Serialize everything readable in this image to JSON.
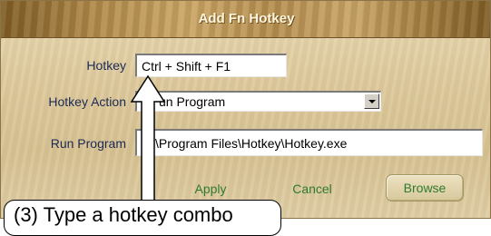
{
  "dialog": {
    "title": "Add Fn Hotkey"
  },
  "form": {
    "hotkey_label": "Hotkey",
    "hotkey_value": "Ctrl + Shift + F1",
    "action_label": "Hotkey Action",
    "action_value": "Run Program",
    "action_visible": "un Program",
    "program_label": "Run Program",
    "program_value": "C:\\Program Files\\Hotkey\\Hotkey.exe",
    "program_visible": "\\Program Files\\Hotkey\\Hotkey.exe"
  },
  "buttons": {
    "apply": "Apply",
    "cancel": "Cancel",
    "browse": "Browse"
  },
  "annotation": {
    "callout_text": "(3) Type a hotkey combo"
  },
  "colors": {
    "button_text": "#2f7a2f",
    "label_text": "#1b2a55",
    "title_text": "#fff6de"
  }
}
